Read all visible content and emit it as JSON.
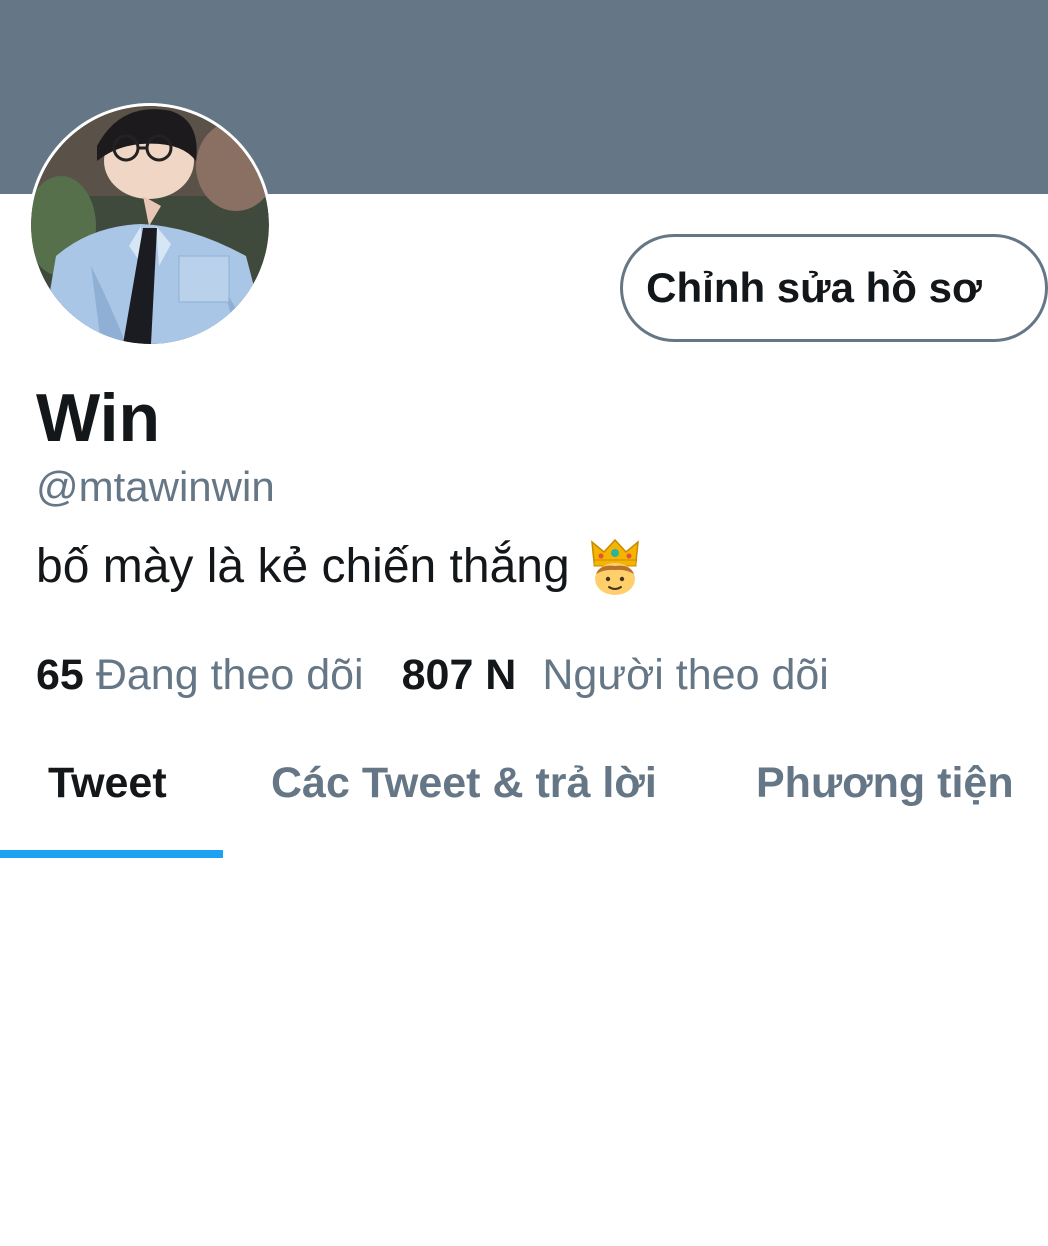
{
  "profile": {
    "display_name": "Win",
    "handle": "@mtawinwin",
    "bio": "bố mày là kẻ chiến thắng",
    "bio_emoji": "prince-emoji-icon"
  },
  "actions": {
    "edit_profile_label": "Chỉnh sửa hồ sơ"
  },
  "stats": {
    "following_count": "65",
    "following_label": "Đang theo dõi",
    "followers_count": "807 N",
    "followers_label": "Người theo dõi"
  },
  "tabs": [
    {
      "label": "Tweet",
      "active": true
    },
    {
      "label": "Các Tweet & trả lời",
      "active": false
    },
    {
      "label": "Phương tiện",
      "active": false
    }
  ],
  "colors": {
    "banner": "#657786",
    "text_primary": "#14171a",
    "text_secondary": "#657786",
    "accent": "#1da1f2"
  }
}
